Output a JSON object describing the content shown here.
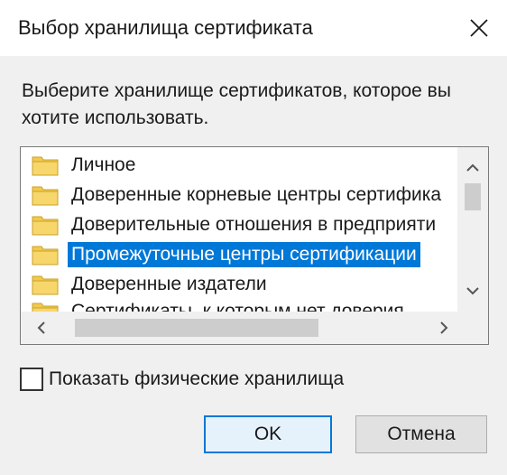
{
  "window": {
    "title": "Выбор хранилища сертификата"
  },
  "instruction": "Выберите хранилище сертификатов, которое вы хотите использовать.",
  "store_list": {
    "items": [
      {
        "label": "Личное",
        "selected": false
      },
      {
        "label": "Доверенные корневые центры сертифика",
        "selected": false
      },
      {
        "label": "Доверительные отношения в предприяти",
        "selected": false
      },
      {
        "label": "Промежуточные центры сертификации",
        "selected": true
      },
      {
        "label": "Доверенные издатели",
        "selected": false
      },
      {
        "label": "Сертификаты, к которым нет доверия",
        "selected": false
      }
    ]
  },
  "show_physical": {
    "label": "Показать физические хранилища",
    "checked": false
  },
  "buttons": {
    "ok": "OK",
    "cancel": "Отмена"
  },
  "colors": {
    "selection": "#0078d7",
    "folder": "#f2c94c",
    "default_button_border": "#0078d7"
  }
}
